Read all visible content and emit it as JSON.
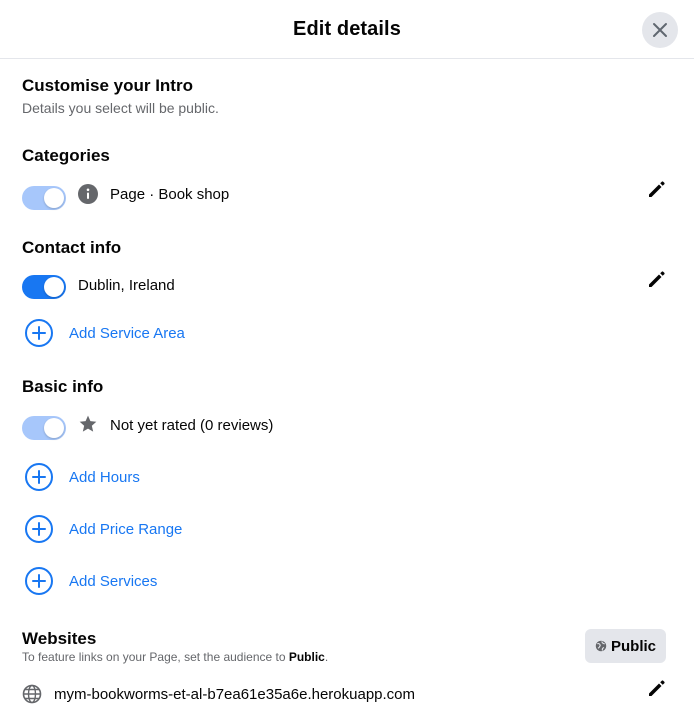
{
  "dialog": {
    "title": "Edit details",
    "close_icon": "close-icon"
  },
  "intro": {
    "heading": "Customise your Intro",
    "subtitle": "Details you select will be public."
  },
  "categories": {
    "heading": "Categories",
    "item_label": "Page · Book shop",
    "toggle_state": "on-disabled",
    "icon": "info-icon"
  },
  "contact_info": {
    "heading": "Contact info",
    "location_label": "Dublin, Ireland",
    "toggle_state": "on",
    "add_service_area_label": "Add Service Area"
  },
  "basic_info": {
    "heading": "Basic info",
    "rating_label": "Not yet rated (0 reviews)",
    "toggle_state": "on-disabled",
    "icon": "star-icon",
    "add_hours_label": "Add Hours",
    "add_price_range_label": "Add Price Range",
    "add_services_label": "Add Services"
  },
  "websites": {
    "heading": "Websites",
    "hint_prefix": "To feature links on your Page, set the audience to ",
    "hint_bold": "Public",
    "hint_suffix": ".",
    "audience_label": "Public",
    "url": "mym-bookworms-et-al-b7ea61e35a6e.herokuapp.com",
    "icon": "globe-icon"
  },
  "colors": {
    "accent": "#1877f2",
    "toggle_faded": "#a7c7fb",
    "icon_grey": "#65676b"
  }
}
